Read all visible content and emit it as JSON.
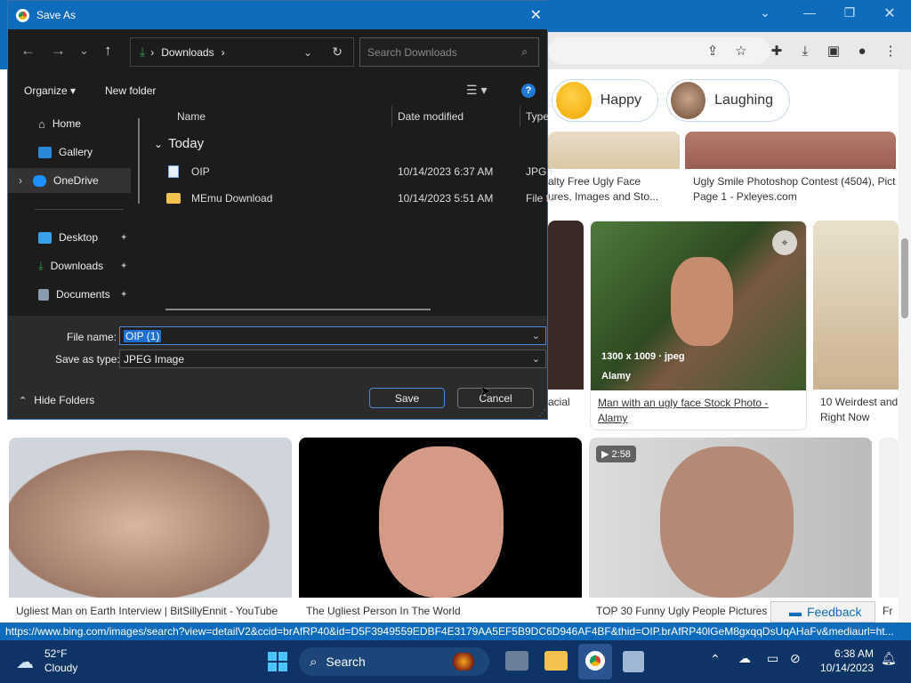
{
  "dialog": {
    "title": "Save As",
    "breadcrumb": [
      "Downloads"
    ],
    "search_placeholder": "Search Downloads",
    "organize_label": "Organize",
    "new_folder_label": "New folder",
    "nav": {
      "items": [
        {
          "label": "Home"
        },
        {
          "label": "Gallery"
        },
        {
          "label": "OneDrive"
        },
        {
          "label": "Desktop"
        },
        {
          "label": "Downloads"
        },
        {
          "label": "Documents"
        }
      ]
    },
    "columns": {
      "name": "Name",
      "date": "Date modified",
      "type": "Type"
    },
    "group_label": "Today",
    "files": [
      {
        "name": "OIP",
        "date": "10/14/2023 6:37 AM",
        "type": "JPG F"
      },
      {
        "name": "MEmu Download",
        "date": "10/14/2023 5:51 AM",
        "type": "File fo"
      }
    ],
    "filename_label": "File name:",
    "filename_value": "OIP (1)",
    "savetype_label": "Save as type:",
    "savetype_value": "JPEG Image",
    "hide_folders_label": "Hide Folders",
    "save_label": "Save",
    "cancel_label": "Cancel"
  },
  "chips": [
    {
      "label": "Happy"
    },
    {
      "label": "Laughing"
    }
  ],
  "results_row1": [
    {
      "caption": "alty Free Ugly Face\nures, Images and Sto..."
    },
    {
      "caption": "Ugly Smile Photoshop Contest (4504), Pict\nPage 1 - Pxleyes.com"
    }
  ],
  "results_row2": [
    {
      "caption": "acial"
    },
    {
      "overlay_size": "1300 x 1009 · jpeg",
      "overlay_source": "Alamy",
      "caption": "Man with an ugly face Stock Photo -\nAlamy"
    },
    {
      "caption": "10 Weirdest and\nRight Now"
    }
  ],
  "results_row3": [
    {
      "caption": "Ugliest Man on Earth Interview | BitSillyEnnit - YouTube"
    },
    {
      "caption": "The Ugliest Person In The World"
    },
    {
      "duration": "2:58",
      "caption": "TOP 30 Funny Ugly People Pictures"
    },
    {
      "caption": "Fr"
    }
  ],
  "feedback_label": "Feedback",
  "status_url": "https://www.bing.com/images/search?view=detailV2&ccid=brAfRP40&id=D5F3949559EDBF4E3179AA5EF5B9DC6D946AF4BF&thid=OIP.brAfRP40lGeM8gxqqDsUqAHaFv&mediaurl=ht...",
  "taskbar": {
    "weather_temp": "52°F",
    "weather_desc": "Cloudy",
    "search_label": "Search",
    "time": "6:38 AM",
    "date": "10/14/2023"
  },
  "colors": {
    "accent": "#0f6cbd",
    "dialog_bg": "#1c1c1c",
    "taskbar": "#0d3466"
  }
}
